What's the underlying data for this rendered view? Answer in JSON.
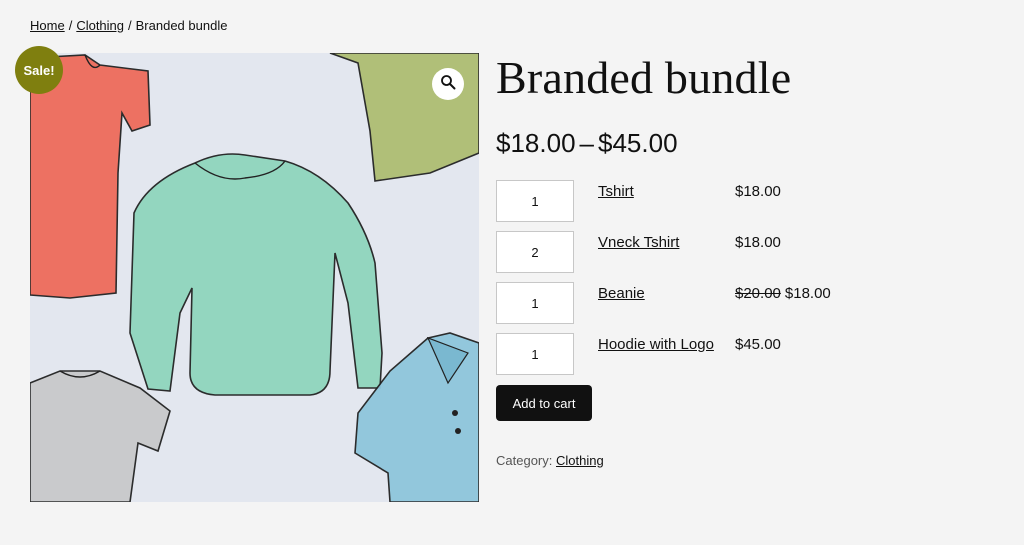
{
  "breadcrumb": {
    "home": "Home",
    "separator": "/",
    "clothing": "Clothing",
    "current": "Branded bundle"
  },
  "gallery": {
    "sale_badge": "Sale!",
    "zoom_icon": "search-icon",
    "image_description_icon": "tshirts-illustration"
  },
  "product": {
    "title": "Branded bundle",
    "price_min": "$18.00",
    "price_separator": "–",
    "price_max": "$45.00"
  },
  "grouped_items": [
    {
      "qty": "1",
      "name": "Tshirt",
      "price": "$18.00",
      "old_price": ""
    },
    {
      "qty": "2",
      "name": "Vneck Tshirt",
      "price": "$18.00",
      "old_price": ""
    },
    {
      "qty": "1",
      "name": "Beanie",
      "price": "$18.00",
      "old_price": "$20.00"
    },
    {
      "qty": "1",
      "name": "Hoodie with Logo",
      "price": "$45.00",
      "old_price": ""
    }
  ],
  "actions": {
    "add_to_cart": "Add to cart"
  },
  "meta": {
    "category_label": "Category:",
    "category_value": "Clothing"
  },
  "colors": {
    "sale_badge": "#7f7f0f",
    "button_bg": "#111111",
    "image_bg": "#e3e7ef"
  }
}
